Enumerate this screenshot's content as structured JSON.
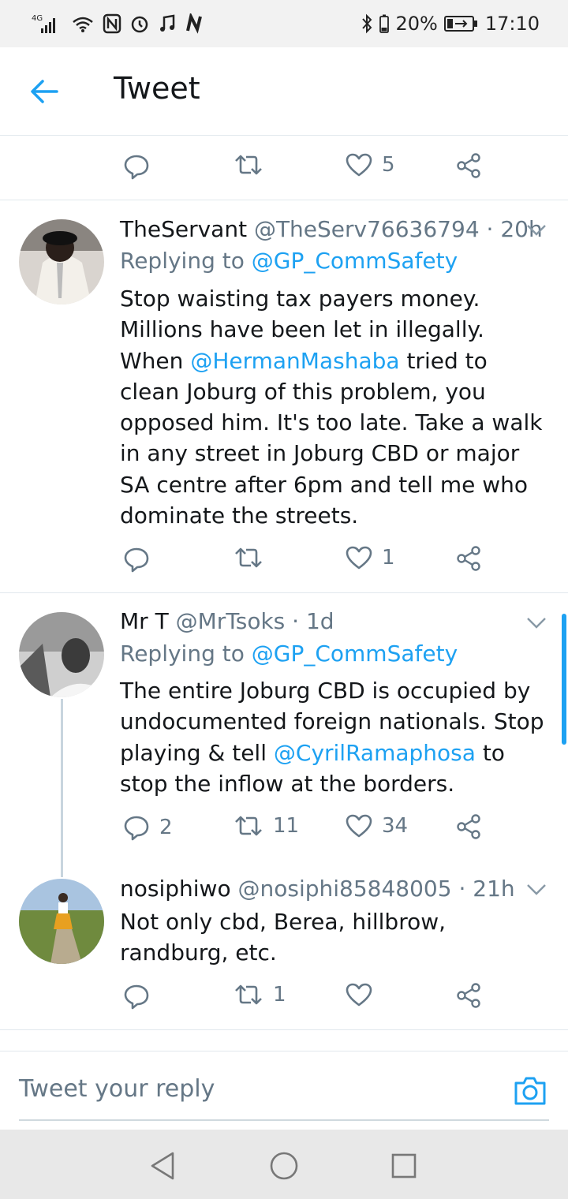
{
  "status_bar": {
    "network": "4G",
    "battery_percent": "20%",
    "time": "17:10"
  },
  "header": {
    "title": "Tweet"
  },
  "colors": {
    "accent": "#1da1f2",
    "secondary_text": "#657786",
    "primary_text": "#14171a"
  },
  "top_actions": {
    "like_count": "5"
  },
  "tweets": [
    {
      "name": "TheServant",
      "handle": "@TheServ76636794",
      "time": "· 20h",
      "replying_prefix": "Replying to",
      "replying_to": "@GP_CommSafety",
      "body_part1": "Stop waisting tax payers money. Millions have been let in illegally. When",
      "mention": "@HermanMashaba",
      "body_part2": "tried to clean Joburg of this problem, you opposed him. It's too late. Take a walk in any street in Joburg CBD or major SA centre after 6pm and tell me who dominate the streets.",
      "reply_count": "",
      "retweet_count": "",
      "like_count": "1"
    },
    {
      "name": "Mr T",
      "handle": "@MrTsoks",
      "time": "· 1d",
      "replying_prefix": "Replying to",
      "replying_to": "@GP_CommSafety",
      "body_part1": "The entire Joburg CBD is occupied by undocumented foreign nationals. Stop playing & tell",
      "mention": "@CyrilRamaphosa",
      "body_part2": "to stop the inflow at the borders.",
      "reply_count": "2",
      "retweet_count": "11",
      "like_count": "34"
    },
    {
      "name": "nosiphiwo",
      "handle": "@nosiphi85848005",
      "time": "· 21h",
      "body": "Not only cbd, Berea, hillbrow, randburg, etc.",
      "reply_count": "",
      "retweet_count": "1",
      "like_count": ""
    }
  ],
  "reply_bar": {
    "placeholder": "Tweet your reply"
  }
}
